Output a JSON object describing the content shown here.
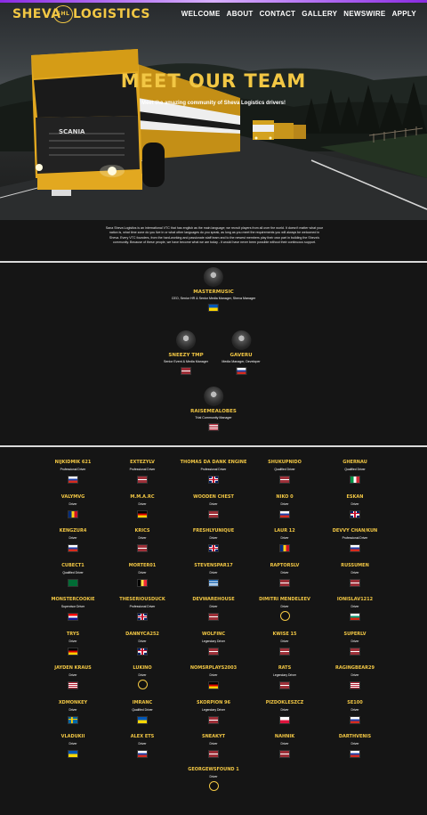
{
  "brand": {
    "left": "SHEVA",
    "badge": "SHL",
    "right": "LOGISTICS",
    "accent": "#f2c744"
  },
  "nav": {
    "items": [
      "WELCOME",
      "ABOUT",
      "CONTACT",
      "GALLERY",
      "NEWSWIRE",
      "APPLY"
    ]
  },
  "hero": {
    "title": "MEET OUR TEAM",
    "subtitle": "Meet the amazing community of Sheva Logistics drivers!",
    "truck_plate": "SCANIA"
  },
  "intro": "Sana Sheva Logistics is an international VTC that has english as the main language; we recruit players from all over the world. It doesn't matter what your nation is, what time zone do you live in or what other languages do you speak, as long as you meet the requirements you will always be welcomed in Sheva. Every VTC founders, from the hard-working and passionate staff team and to the newest members play their own part in building the Sheva's community. Because of these people, we have become what we are today - it would have never been possible without their continuous support.",
  "leadership": [
    {
      "name": "MASTERMUSIC",
      "role": "CEO, Senior HR & Senior Media Manager, Sheva Manager",
      "flag": "ua"
    },
    {
      "name": "SNEEZY TMP",
      "role": "Senior Event & Media Manager",
      "flag": "lv"
    },
    {
      "name": "GAVERU",
      "role": "Media Manager, Developer",
      "flag": "ru"
    },
    {
      "name": "RAISEMEALOBES",
      "role": "Trial Community Manager",
      "flag": "us"
    }
  ],
  "drivers": [
    {
      "name": "NIJKIDMIK 621",
      "role": "Professional Driver",
      "flag": "ru"
    },
    {
      "name": "EXTEZYLV",
      "role": "Professional Driver",
      "flag": "lv"
    },
    {
      "name": "THOMAS DA DANK ENGINE",
      "role": "Professional Driver",
      "flag": "gb"
    },
    {
      "name": "SHUKUPNIDO",
      "role": "Qualified Driver",
      "flag": "lv"
    },
    {
      "name": "GHERNAU",
      "role": "Qualified Driver",
      "flag": "it"
    },
    {
      "name": "VALYMVG",
      "role": "Driver",
      "flag": "ro"
    },
    {
      "name": "M.M.A.RC",
      "role": "Driver",
      "flag": "de"
    },
    {
      "name": "WOODEN CHEST",
      "role": "Driver",
      "flag": "lv"
    },
    {
      "name": "NIKO 0",
      "role": "Driver",
      "flag": "ru"
    },
    {
      "name": "ESKAN",
      "role": "Driver",
      "flag": "gb"
    },
    {
      "name": "KENGZUR4",
      "role": "Driver",
      "flag": "ru"
    },
    {
      "name": "KRICS",
      "role": "Driver",
      "flag": "lv"
    },
    {
      "name": "FRESHLYUNIQUE",
      "role": "Driver",
      "flag": "gb"
    },
    {
      "name": "LAUR 12",
      "role": "Driver",
      "flag": "ro"
    },
    {
      "name": "DEVVY CHAN/KUN",
      "role": "Professional Driver",
      "flag": "ru"
    },
    {
      "name": "CUBECT1",
      "role": "Qualified Driver",
      "flag": "sa"
    },
    {
      "name": "MORTER01",
      "role": "Driver",
      "flag": "be"
    },
    {
      "name": "STEVENSPAR17",
      "role": "Driver",
      "flag": "gr"
    },
    {
      "name": "RAPTORSLV",
      "role": "Driver",
      "flag": "lv"
    },
    {
      "name": "RUSSUMEN",
      "role": "Driver",
      "flag": "lv"
    },
    {
      "name": "MONSTERCOOKIE",
      "role": "Supervisor Driver",
      "flag": "hr"
    },
    {
      "name": "THESERIOUSDUCK",
      "role": "Professional Driver",
      "flag": "gb"
    },
    {
      "name": "DEVWAREHOUSE",
      "role": "Driver",
      "flag": "lv"
    },
    {
      "name": "DIMITRI MENDELEEV",
      "role": "Driver",
      "flag": "round"
    },
    {
      "name": "IONISLAV1212",
      "role": "Driver",
      "flag": "bg"
    },
    {
      "name": "TRYS",
      "role": "Driver",
      "flag": "de"
    },
    {
      "name": "DANNYCA252",
      "role": "Driver",
      "flag": "gb"
    },
    {
      "name": "WOLFINC",
      "role": "Legendary Driver",
      "flag": "lv"
    },
    {
      "name": "KWISE 15",
      "role": "Driver",
      "flag": "lv"
    },
    {
      "name": "SUPERLV",
      "role": "Driver",
      "flag": "lv"
    },
    {
      "name": "JAYDEN KRAUS",
      "role": "Driver",
      "flag": "us"
    },
    {
      "name": "LUKINO",
      "role": "Driver",
      "flag": "round"
    },
    {
      "name": "NOMSRPLAYS2003",
      "role": "Driver",
      "flag": "de"
    },
    {
      "name": "RATS",
      "role": "Legendary Driver",
      "flag": "lv"
    },
    {
      "name": "RAGINGBEAR29",
      "role": "Driver",
      "flag": "us"
    },
    {
      "name": "XDMONKEY",
      "role": "Driver",
      "flag": "se"
    },
    {
      "name": "IMRANC",
      "role": "Qualified Driver",
      "flag": "ua"
    },
    {
      "name": "SKORPION 96",
      "role": "Legendary Driver",
      "flag": "lv"
    },
    {
      "name": "PIZDOKLESZCZ",
      "role": "Driver",
      "flag": "pl"
    },
    {
      "name": "SE100",
      "role": "Driver",
      "flag": "ru"
    },
    {
      "name": "VLADUKII",
      "role": "Driver",
      "flag": "ua"
    },
    {
      "name": "ALEX ETS",
      "role": "Driver",
      "flag": "ru"
    },
    {
      "name": "SNEAKYT",
      "role": "Driver",
      "flag": "lv"
    },
    {
      "name": "NAHNIK",
      "role": "Driver",
      "flag": "lv"
    },
    {
      "name": "DARTHVENIS",
      "role": "Driver",
      "flag": "ru"
    },
    {
      "name": "GEORGEWSFOUND 1",
      "role": "Driver",
      "flag": "round"
    }
  ]
}
